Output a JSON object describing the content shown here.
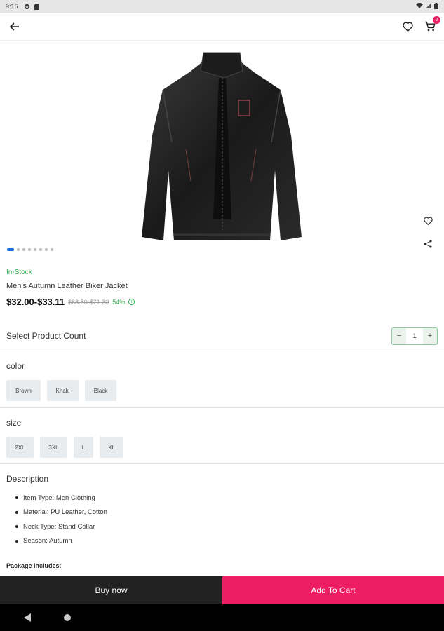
{
  "status_bar": {
    "time": "9:16"
  },
  "app_bar": {
    "cart_count": "2"
  },
  "product": {
    "stock_status": "In-Stock",
    "name": "Men's Autumn Leather Biker Jacket",
    "price": "$32.00-$33.11",
    "old_price": "$68.50-$71.30",
    "discount": "54%",
    "image_count": 8,
    "active_image": 0
  },
  "quantity": {
    "label": "Select Product Count",
    "value": "1",
    "minus": "−",
    "plus": "+"
  },
  "color": {
    "title": "color",
    "options": [
      "Brown",
      "Khaki",
      "Black"
    ]
  },
  "size": {
    "title": "size",
    "options": [
      "2XL",
      "3XL",
      "L",
      "XL"
    ]
  },
  "description": {
    "title": "Description",
    "items": [
      "Item Type: Men Clothing",
      "Material: PU Leather, Cotton",
      "Neck Type: Stand Collar",
      "Season: Autumn"
    ],
    "package_label": "Package Includes:"
  },
  "actions": {
    "buy_now": "Buy now",
    "add_to_cart": "Add To Cart"
  },
  "colors": {
    "accent": "#ec1d62",
    "in_stock": "#2cae4f",
    "dark": "#222222",
    "active_dot": "#1e6fd9"
  }
}
